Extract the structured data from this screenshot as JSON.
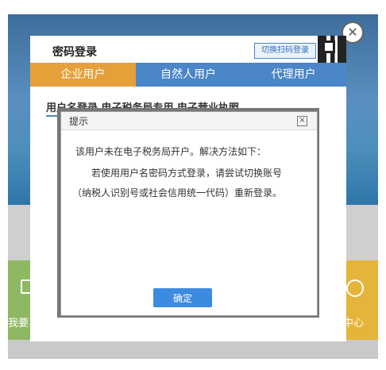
{
  "background": {
    "left_card_text": "我要",
    "right_card_text": "中心"
  },
  "login": {
    "title": "密码登录",
    "scan_label": "切换扫码登录",
    "tabs": [
      {
        "label": "企业用户",
        "active": true
      },
      {
        "label": "自然人用户",
        "active": false
      },
      {
        "label": "代理用户",
        "active": false
      }
    ],
    "subtitle": "用户名登录  电子税务局专用  电子营业执照",
    "close_symbol": "✕"
  },
  "dialog": {
    "title": "提示",
    "close_symbol": "×",
    "message_line1": "该用户未在电子税务局开户。解决方法如下：",
    "message_line2": "若使用用户名密码方式登录，请尝试切换账号",
    "message_line3": "（纳税人识别号或社会信用统一代码）重新登录。",
    "ok_label": "确定"
  },
  "colors": {
    "tab_active": "#e6a03a",
    "tab_inactive": "#4a86c8",
    "ok_button": "#3d8be0"
  }
}
